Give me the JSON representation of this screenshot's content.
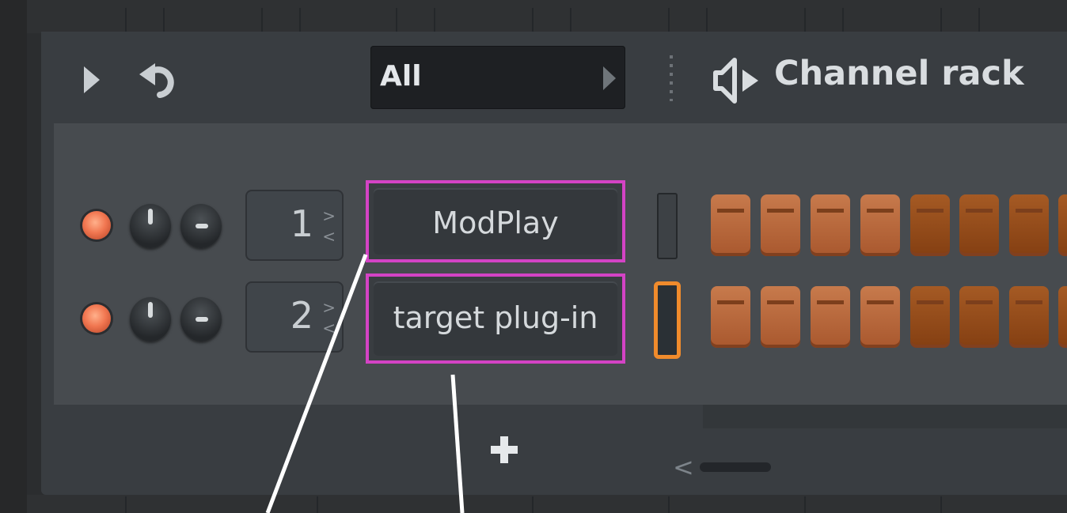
{
  "toolbar": {
    "filter_value": "All",
    "play_icon": "play-triangle",
    "undo_icon": "undo-arrow"
  },
  "window": {
    "title": "Channel rack",
    "icon": "speaker-icon"
  },
  "channels": [
    {
      "number": "1",
      "name": "ModPlay",
      "selected": false
    },
    {
      "number": "2",
      "name": "target plug-in",
      "selected": true
    }
  ],
  "footer": {
    "add_icon": "plus"
  },
  "colors": {
    "highlight": "#d443c5",
    "selection": "#f08b2c",
    "pad_light": "#c77a4c",
    "pad_dark": "#a55a24",
    "led": "#f17751"
  }
}
